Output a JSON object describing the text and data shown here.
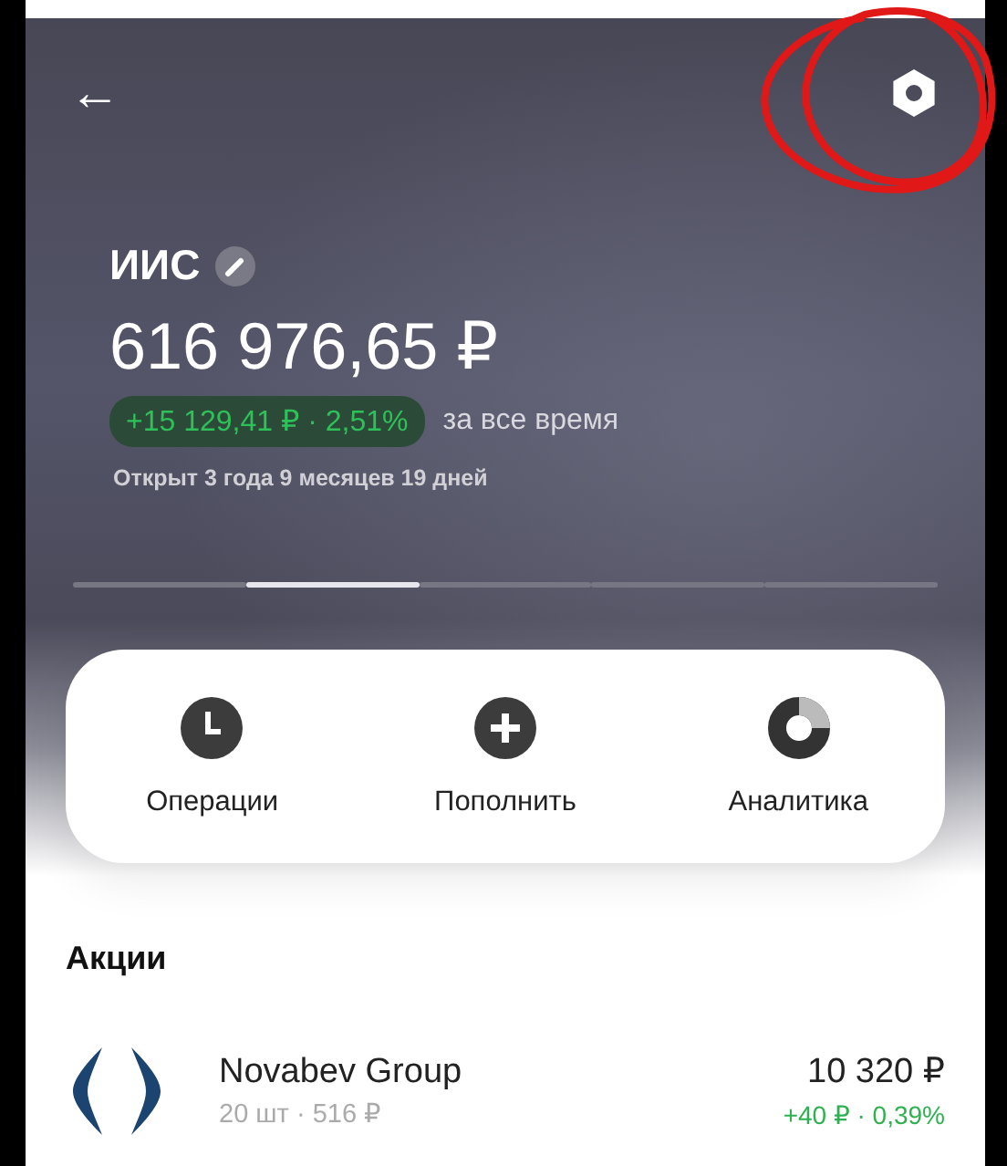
{
  "header": {
    "back": "←"
  },
  "account": {
    "name": "ИИС",
    "balance": "616 976,65 ₽",
    "gain": "+15 129,41 ₽ · 2,51%",
    "gain_period": "за все время",
    "opened": "Открыт 3 года 9 месяцев 19 дней"
  },
  "pager": [
    {
      "selected": false
    },
    {
      "selected": true
    },
    {
      "selected": false
    },
    {
      "selected": false
    },
    {
      "selected": false
    }
  ],
  "actions": [
    {
      "kind": "clock",
      "label": "Операции"
    },
    {
      "kind": "plus",
      "label": "Пополнить"
    },
    {
      "kind": "donut",
      "label": "Аналитика"
    }
  ],
  "section_title": "Акции",
  "holdings": [
    {
      "name": "Novabev Group",
      "detail": "20 шт · 516 ₽",
      "value": "10 320 ₽",
      "change": "+40 ₽ · 0,39%"
    }
  ]
}
